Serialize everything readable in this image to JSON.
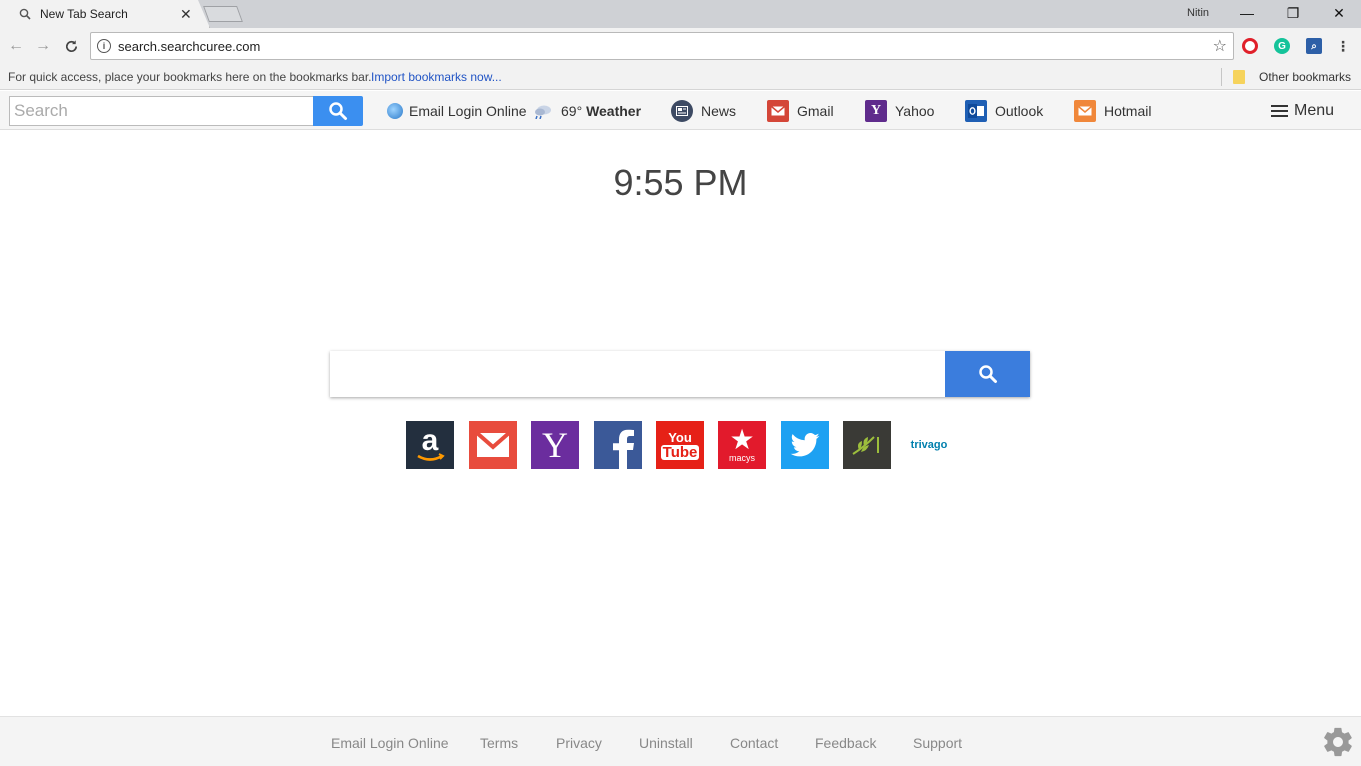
{
  "browser": {
    "tab_title": "New Tab Search",
    "tab_close": "✕",
    "user": "Nitin",
    "window_controls": {
      "minimize": "—",
      "restore": "❐",
      "close": "✕"
    },
    "url": "search.searchcuree.com",
    "extensions": [
      "opera-icon",
      "grammarly-icon",
      "search-extension-icon",
      "more-icon"
    ]
  },
  "bookmarks": {
    "hint": "For quick access, place your bookmarks here on the bookmarks bar.",
    "import_link": "Import bookmarks now...",
    "other": "Other bookmarks"
  },
  "site_header": {
    "search_placeholder": "Search",
    "email_login": "Email Login Online",
    "weather_temp": "69°",
    "weather_label": "Weather",
    "links": [
      {
        "label": "News",
        "icon": "news-icon"
      },
      {
        "label": "Gmail",
        "icon": "gmail-icon"
      },
      {
        "label": "Yahoo",
        "icon": "yahoo-icon"
      },
      {
        "label": "Outlook",
        "icon": "outlook-icon"
      },
      {
        "label": "Hotmail",
        "icon": "hotmail-icon"
      }
    ],
    "menu": "Menu"
  },
  "main": {
    "time": "9:55 PM",
    "search_value": "",
    "shortcuts": [
      {
        "name": "amazon",
        "color": "#232f3e"
      },
      {
        "name": "gmail",
        "color": "#e84c3d"
      },
      {
        "name": "yahoo",
        "color": "#6b2d9e"
      },
      {
        "name": "facebook",
        "color": "#3b5998"
      },
      {
        "name": "youtube",
        "color": "#e62117"
      },
      {
        "name": "macys",
        "color": "#e21a2c",
        "label": "macys"
      },
      {
        "name": "twitter",
        "color": "#1da1f2"
      },
      {
        "name": "ancestry",
        "color": "#3a3a36"
      },
      {
        "name": "trivago",
        "label": "trivago"
      }
    ]
  },
  "footer": {
    "links": [
      "Email Login Online",
      "Terms",
      "Privacy",
      "Uninstall",
      "Contact",
      "Feedback",
      "Support"
    ]
  },
  "colors": {
    "accent_blue": "#3b8ff0",
    "main_search_blue": "#3b7ddd"
  }
}
